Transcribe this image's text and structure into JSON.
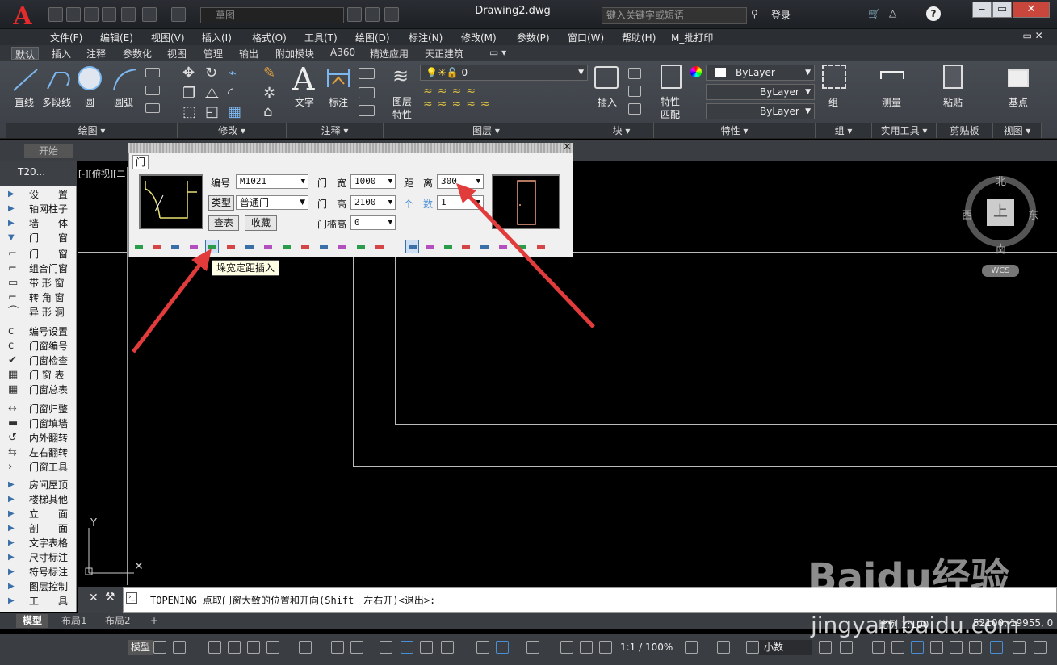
{
  "titlebar": {
    "title": "Drawing2.dwg",
    "workspace": "草图",
    "search_placeholder": "键入关键字或短语",
    "login": "登录"
  },
  "menus": [
    "文件(F)",
    "编辑(E)",
    "视图(V)",
    "插入(I)",
    "格式(O)",
    "工具(T)",
    "绘图(D)",
    "标注(N)",
    "修改(M)",
    "参数(P)",
    "窗口(W)",
    "帮助(H)",
    "M_批打印"
  ],
  "ribbon_tabs": [
    "默认",
    "插入",
    "注释",
    "参数化",
    "视图",
    "管理",
    "输出",
    "附加模块",
    "A360",
    "精选应用",
    "天正建筑"
  ],
  "ribbon": {
    "draw_tools": [
      "直线",
      "多段线",
      "圆",
      "圆弧"
    ],
    "annotate_tools": [
      "文字",
      "标注"
    ],
    "layer_tools": [
      "图层特性"
    ],
    "layer_value": "0",
    "insert": "插入",
    "match": "特性匹配",
    "bylayer1": "ByLayer",
    "bylayer2": "ByLayer",
    "bylayer3": "ByLayer",
    "group": "组",
    "measure": "测量",
    "paste": "粘贴",
    "basepoint": "基点",
    "panels": [
      "绘图",
      "修改",
      "注释",
      "图层",
      "块",
      "特性",
      "组",
      "实用工具",
      "剪贴板",
      "视图"
    ]
  },
  "filetab": "开始",
  "leftpanel": {
    "header": "T20...",
    "items": [
      "设　　置",
      "轴网柱子",
      "墙　　体",
      "门　　窗"
    ],
    "subitems": [
      "门　　窗",
      "组合门窗",
      "带 形 窗",
      "转 角 窗",
      "异 形 洞",
      "编号设置",
      "门窗编号",
      "门窗检查",
      "门 窗 表",
      "门窗总表",
      "门窗归整",
      "门窗填墙",
      "内外翻转",
      "左右翻转",
      "门窗工具"
    ],
    "items2": [
      "房间屋顶",
      "楼梯其他",
      "立　　面",
      "剖　　面",
      "文字表格",
      "尺寸标注",
      "符号标注",
      "图层控制",
      "工　　具"
    ]
  },
  "viewlabel": "[-][俯视][二",
  "compass": {
    "n": "北",
    "s": "南",
    "e": "东",
    "w": "西",
    "top": "上",
    "wcs": "WCS"
  },
  "dialog": {
    "tab": "门",
    "num_label": "编号",
    "num_value": "M1021",
    "type_btn": "类型",
    "type_value": "普通门",
    "lookup_btn": "查表",
    "fav_btn": "收藏",
    "width_label": "门　宽",
    "width_value": "1000",
    "height_label": "门　高",
    "height_value": "2100",
    "sill_label": "门槛高",
    "sill_value": "0",
    "dist_label": "距　离",
    "dist_value": "300",
    "count_label": "个　数",
    "count_value": "1"
  },
  "tooltip": "垛宽定距插入",
  "command": "TOPENING 点取门窗大致的位置和开向(Shift－左右开)<退出>:",
  "layout_tabs": [
    "模型",
    "布局1",
    "布局2"
  ],
  "status": {
    "model": "模型",
    "scale": "1:1 / 100%",
    "decimal": "小数",
    "scale_label": "比例 1:100",
    "coords": "52100, 19955, 0"
  },
  "watermark": "Baidu经验",
  "watermark2": "jingyan.baidu.com"
}
